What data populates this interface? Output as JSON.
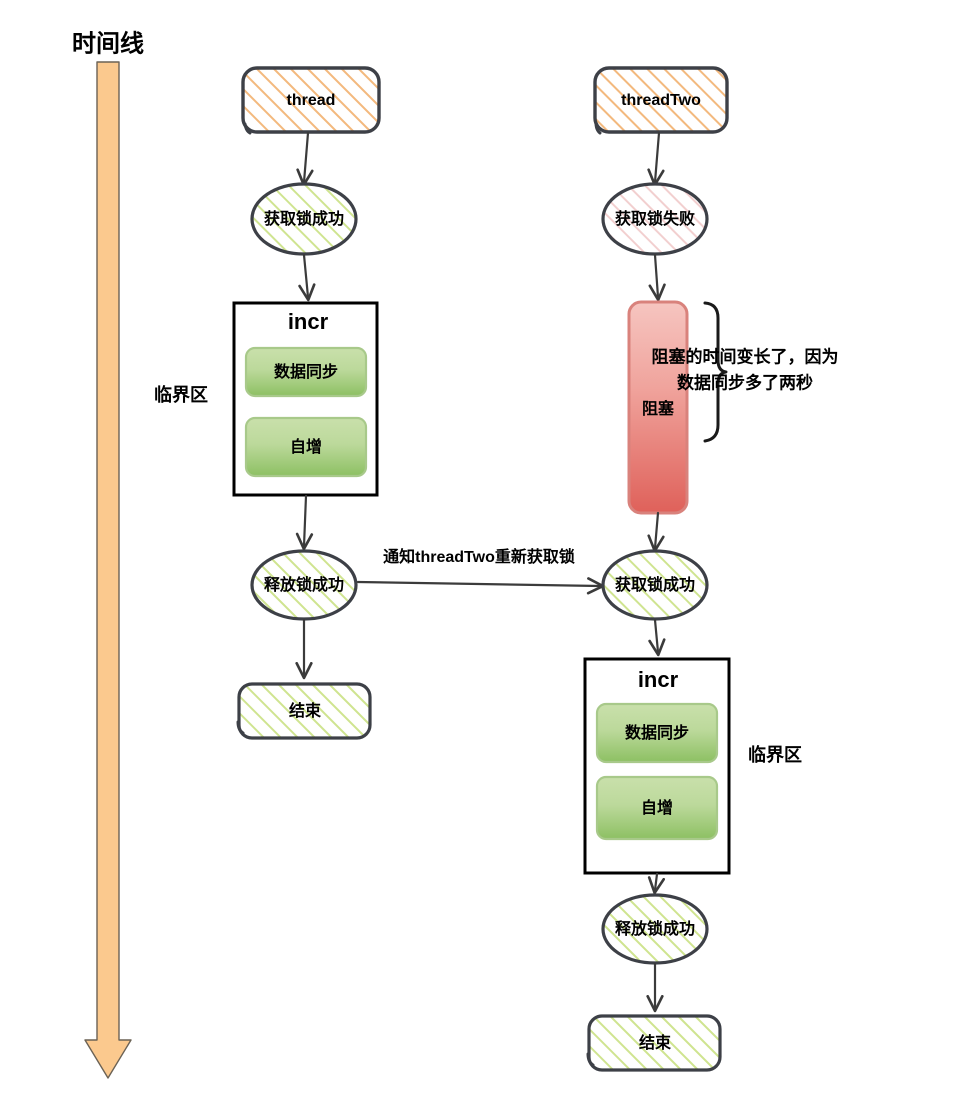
{
  "diagram": {
    "title_label": "时间线",
    "timeline": {
      "name": "timeline-arrow",
      "color": "#fbc98e",
      "border": "#6b6255"
    },
    "columns": [
      {
        "id": "thread-one",
        "critical_section_label": "临界区",
        "nodes": [
          {
            "id": "thread-start",
            "shape": "rounded-rect",
            "label": "thread",
            "fill_pattern": "orange-hatch"
          },
          {
            "id": "acquire-lock-success",
            "shape": "ellipse",
            "label": "获取锁成功",
            "fill_pattern": "green-hatch"
          },
          {
            "id": "incr-block",
            "shape": "rect",
            "label": "incr",
            "children": [
              {
                "id": "data-sync",
                "label": "数据同步",
                "fill": "green-gradient"
              },
              {
                "id": "increment",
                "label": "自增",
                "fill": "green-gradient"
              }
            ]
          },
          {
            "id": "release-lock-success",
            "shape": "ellipse",
            "label": "释放锁成功",
            "fill_pattern": "green-hatch"
          },
          {
            "id": "end",
            "shape": "rounded-rect",
            "label": "结束",
            "fill_pattern": "green-hatch"
          }
        ]
      },
      {
        "id": "thread-two",
        "critical_section_label": "临界区",
        "nodes": [
          {
            "id": "threadtwo-start",
            "shape": "rounded-rect",
            "label": "threadTwo",
            "fill_pattern": "orange-hatch"
          },
          {
            "id": "acquire-lock-failed",
            "shape": "ellipse",
            "label": "获取锁失败",
            "fill_pattern": "pink-hatch"
          },
          {
            "id": "blocked",
            "shape": "tall-rounded-rect",
            "label": "阻塞",
            "fill": "red-gradient"
          },
          {
            "id": "acquire-lock-success-2",
            "shape": "ellipse",
            "label": "获取锁成功",
            "fill_pattern": "green-hatch"
          },
          {
            "id": "incr-block-2",
            "shape": "rect",
            "label": "incr",
            "children": [
              {
                "id": "data-sync-2",
                "label": "数据同步",
                "fill": "green-gradient"
              },
              {
                "id": "increment-2",
                "label": "自增",
                "fill": "green-gradient"
              }
            ]
          },
          {
            "id": "release-lock-success-2",
            "shape": "ellipse",
            "label": "释放锁成功",
            "fill_pattern": "green-hatch"
          },
          {
            "id": "end-2",
            "shape": "rounded-rect",
            "label": "结束",
            "fill_pattern": "green-hatch"
          }
        ]
      }
    ],
    "cross_edge_label": "通知threadTwo重新获取锁",
    "brace_annotation_line1": "阻塞的时间变长了，因为",
    "brace_annotation_line2": "数据同步多了两秒",
    "colors": {
      "orange_hatch": "#f3b97e",
      "green_hatch": "#c4de7c",
      "pink_hatch": "#f0c4c4",
      "green_box_top": "#bedaa0",
      "green_box_bottom": "#8dc063",
      "red_box_top": "#f4b8b4",
      "red_box_bottom": "#e0645d",
      "stroke": "#3d4047",
      "timeline": "#fbc98e"
    }
  }
}
